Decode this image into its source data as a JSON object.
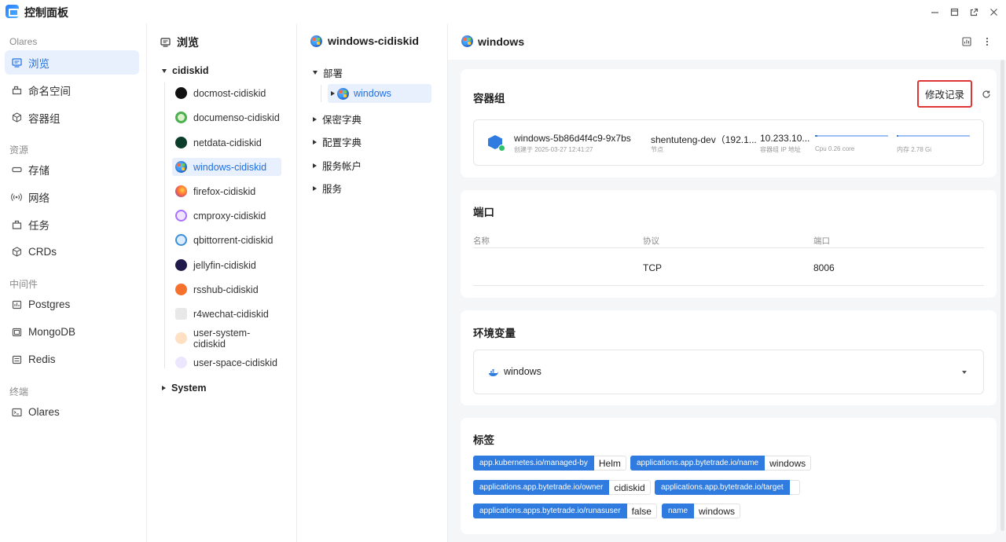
{
  "window": {
    "title": "控制面板",
    "controls": [
      "minimize-icon",
      "maximize-icon",
      "popout-icon",
      "close-icon"
    ]
  },
  "nav": {
    "sections": [
      {
        "label": "Olares",
        "items": [
          {
            "label": "浏览",
            "icon": "browse-icon",
            "active": true
          },
          {
            "label": "命名空间",
            "icon": "namespace-icon"
          },
          {
            "label": "容器组",
            "icon": "cube-icon"
          }
        ]
      },
      {
        "label": "资源",
        "items": [
          {
            "label": "存储",
            "icon": "storage-icon"
          },
          {
            "label": "网络",
            "icon": "network-icon"
          },
          {
            "label": "任务",
            "icon": "task-icon"
          },
          {
            "label": "CRDs",
            "icon": "crd-icon"
          }
        ]
      },
      {
        "label": "中间件",
        "items": [
          {
            "label": "Postgres",
            "icon": "postgres-icon"
          },
          {
            "label": "MongoDB",
            "icon": "mongodb-icon"
          },
          {
            "label": "Redis",
            "icon": "redis-icon"
          }
        ]
      },
      {
        "label": "终端",
        "items": [
          {
            "label": "Olares",
            "icon": "terminal-icon"
          }
        ]
      }
    ]
  },
  "browse": {
    "title": "浏览",
    "group": "cidiskid",
    "apps": [
      {
        "label": "docmost-cidiskid",
        "color": "#111111"
      },
      {
        "label": "documenso-cidiskid",
        "color": "#4caf50"
      },
      {
        "label": "netdata-cidiskid",
        "color": "#0b3d2a"
      },
      {
        "label": "windows-cidiskid",
        "color": "#2f7be0",
        "active": true
      },
      {
        "label": "firefox-cidiskid",
        "color": "#ff7139"
      },
      {
        "label": "cmproxy-cidiskid",
        "color": "#a970ff"
      },
      {
        "label": "qbittorrent-cidiskid",
        "color": "#3d8fd6"
      },
      {
        "label": "jellyfin-cidiskid",
        "color": "#1e1b4b"
      },
      {
        "label": "rsshub-cidiskid",
        "color": "#f5712c"
      },
      {
        "label": "r4wechat-cidiskid",
        "color": "#d9d9d9"
      },
      {
        "label": "user-system-cidiskid",
        "color": "#ffe0c2"
      },
      {
        "label": "user-space-cidiskid",
        "color": "#ece6ff"
      }
    ],
    "system_group": "System"
  },
  "resources": {
    "title": "windows-cidiskid",
    "deploy_label": "部署",
    "deploy_child": "windows",
    "others": [
      "保密字典",
      "配置字典",
      "服务帐户",
      "服务"
    ]
  },
  "detail": {
    "title": "windows",
    "header_icons": [
      "chart-icon",
      "more-icon"
    ],
    "pods": {
      "title": "容器组",
      "modify_label": "修改记录",
      "pod_name": "windows-5b86d4f4c9-9x7bs",
      "created": "创建于 2025-03-27 12:41:27",
      "node": "shentuteng-dev（192.1...",
      "node_label": "节点",
      "ip": "10.233.10...",
      "ip_label": "容器组 IP 地址",
      "cpu_label": "Cpu 0.26 core",
      "cpu_fraction": 0.03,
      "mem_label": "内存 2.78 Gi",
      "mem_fraction": 0.02
    },
    "ports": {
      "title": "端口",
      "headers": [
        "名称",
        "协议",
        "端口"
      ],
      "rows": [
        [
          "",
          "TCP",
          "8006"
        ]
      ]
    },
    "env": {
      "title": "环境变量",
      "container": "windows"
    },
    "labels": {
      "title": "标签",
      "tags": [
        {
          "key": "app.kubernetes.io/managed-by",
          "value": "Helm"
        },
        {
          "key": "applications.app.bytetrade.io/name",
          "value": "windows"
        },
        {
          "key": "applications.app.bytetrade.io/owner",
          "value": "cidiskid"
        },
        {
          "key": "applications.app.bytetrade.io/target",
          "value": ""
        },
        {
          "key": "applications.apps.bytetrade.io/runasuser",
          "value": "false"
        },
        {
          "key": "name",
          "value": "windows"
        }
      ]
    }
  }
}
